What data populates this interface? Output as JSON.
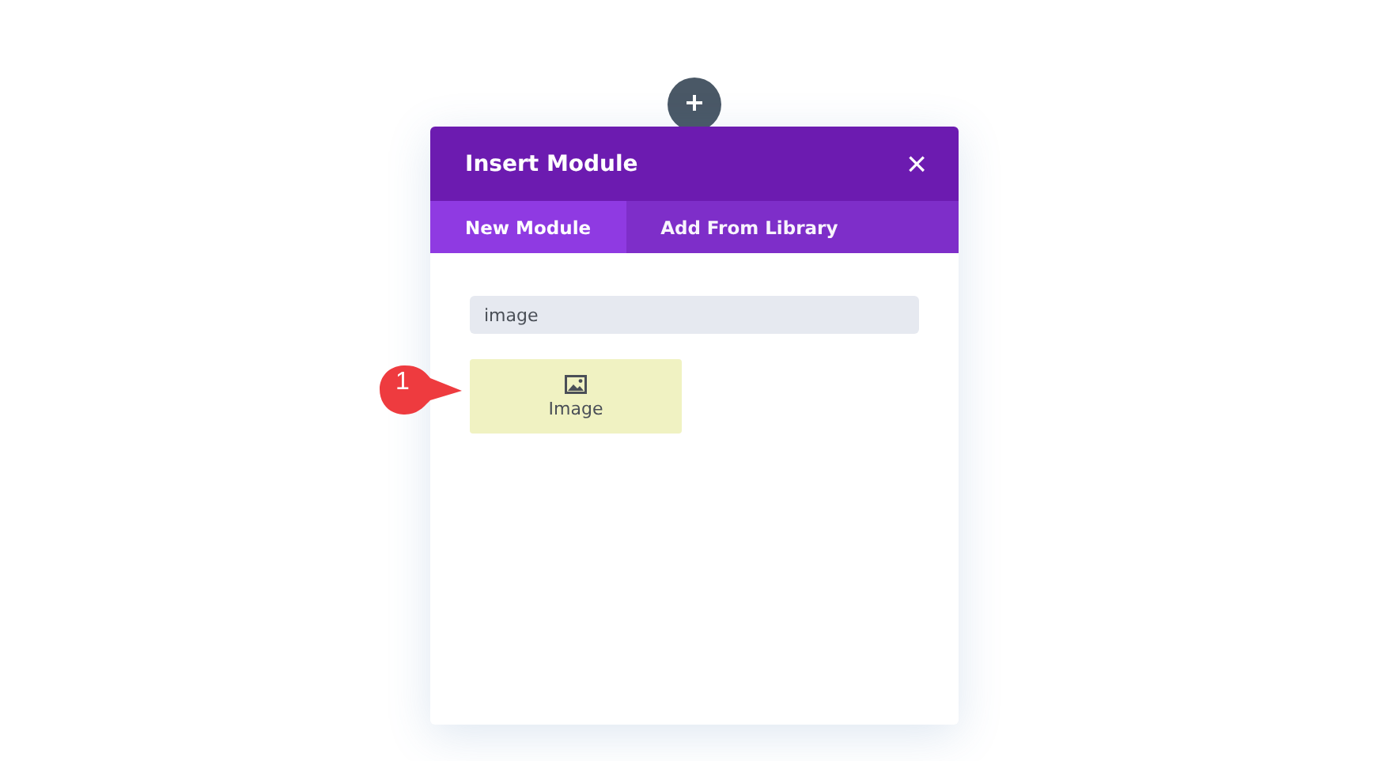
{
  "modal": {
    "title": "Insert Module",
    "close": "×"
  },
  "tabs": [
    {
      "label": "New Module",
      "selected": true
    },
    {
      "label": "Add From Library",
      "selected": false
    }
  ],
  "search": {
    "value": "image"
  },
  "modules": [
    {
      "label": "Image",
      "highlighted": true
    }
  ],
  "callout": {
    "number": "1"
  }
}
